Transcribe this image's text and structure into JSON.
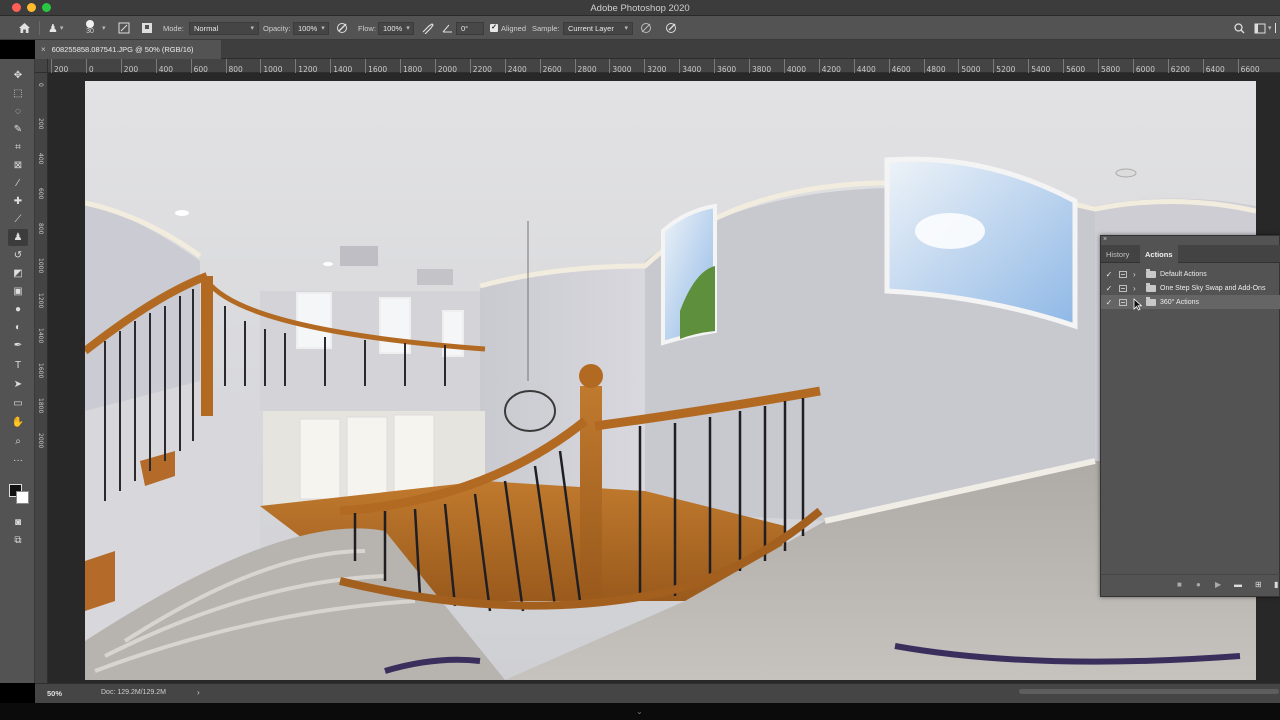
{
  "app": {
    "title": "Adobe Photoshop 2020"
  },
  "options_bar": {
    "brush_size": "30",
    "mode_label": "Mode:",
    "mode_value": "Normal",
    "opacity_label": "Opacity:",
    "opacity_value": "100%",
    "flow_label": "Flow:",
    "flow_value": "100%",
    "angle_value": "0°",
    "aligned_label": "Aligned",
    "aligned_checked": true,
    "sample_label": "Sample:",
    "sample_value": "Current Layer"
  },
  "document": {
    "tab_title": "608255858.087541.JPG @ 50% (RGB/16)",
    "zoom": "50%",
    "doc_size": "Doc: 129.2M/129.2M"
  },
  "ruler": {
    "top_ticks": [
      "200",
      "0",
      "200",
      "400",
      "600",
      "800",
      "1000",
      "1200",
      "1400",
      "1600",
      "1800",
      "2000",
      "2200",
      "2400",
      "2600",
      "2800",
      "3000",
      "3200",
      "3400",
      "3600",
      "3800",
      "4000",
      "4200",
      "4400",
      "4600",
      "4800",
      "5000",
      "5200",
      "5400",
      "5600",
      "5800",
      "6000",
      "6200",
      "6400",
      "6600"
    ],
    "left_ticks": [
      "0",
      "200",
      "400",
      "600",
      "800",
      "1000",
      "1200",
      "1400",
      "1600",
      "1800",
      "2000"
    ]
  },
  "tools": [
    {
      "name": "move-tool-icon",
      "glyph": "✥"
    },
    {
      "name": "marquee-tool-icon",
      "glyph": "⬚"
    },
    {
      "name": "lasso-tool-icon",
      "glyph": "◌"
    },
    {
      "name": "quick-select-tool-icon",
      "glyph": "✎"
    },
    {
      "name": "crop-tool-icon",
      "glyph": "⌗"
    },
    {
      "name": "frame-tool-icon",
      "glyph": "⊠"
    },
    {
      "name": "eyedropper-tool-icon",
      "glyph": "⁄"
    },
    {
      "name": "healing-brush-tool-icon",
      "glyph": "✚"
    },
    {
      "name": "brush-tool-icon",
      "glyph": "⟋"
    },
    {
      "name": "clone-stamp-tool-icon",
      "glyph": "♟"
    },
    {
      "name": "history-brush-tool-icon",
      "glyph": "↺"
    },
    {
      "name": "eraser-tool-icon",
      "glyph": "◩"
    },
    {
      "name": "gradient-tool-icon",
      "glyph": "▣"
    },
    {
      "name": "blur-tool-icon",
      "glyph": "●"
    },
    {
      "name": "dodge-tool-icon",
      "glyph": "◐"
    },
    {
      "name": "pen-tool-icon",
      "glyph": "✒"
    },
    {
      "name": "type-tool-icon",
      "glyph": "T"
    },
    {
      "name": "path-select-tool-icon",
      "glyph": "➤"
    },
    {
      "name": "rectangle-tool-icon",
      "glyph": "▭"
    },
    {
      "name": "hand-tool-icon",
      "glyph": "✋"
    },
    {
      "name": "zoom-tool-icon",
      "glyph": "⌕"
    },
    {
      "name": "more-tools-icon",
      "glyph": "···"
    }
  ],
  "panel": {
    "tabs": [
      "History",
      "Actions"
    ],
    "active_tab": "Actions",
    "actions": [
      {
        "label": "Default Actions",
        "checked": true,
        "selected": false
      },
      {
        "label": "One Step Sky Swap and Add-Ons",
        "checked": true,
        "selected": false
      },
      {
        "label": "360° Actions",
        "checked": true,
        "selected": true
      }
    ]
  },
  "colors": {
    "ui_panel": "#535353",
    "ui_dark": "#3c3c3c",
    "canvas_bg": "#282828",
    "selected_row": "#656565"
  }
}
